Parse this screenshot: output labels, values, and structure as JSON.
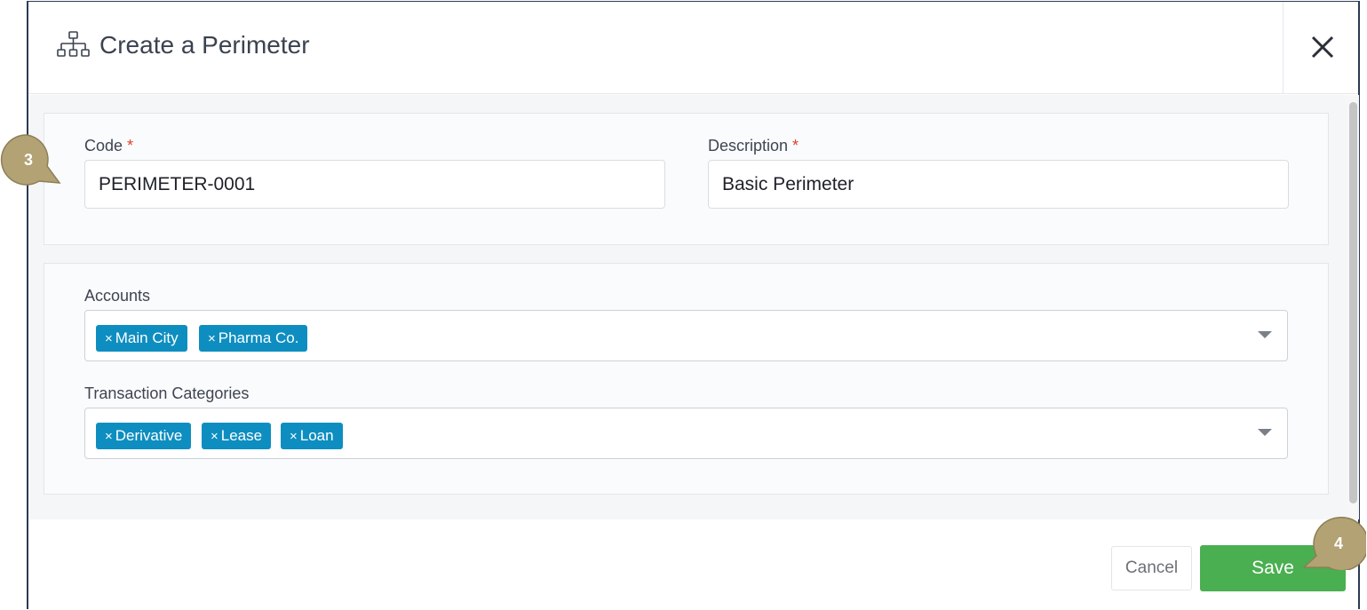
{
  "dialog": {
    "title": "Create a Perimeter",
    "title_icon": "sitemap-icon",
    "close_icon": "close-icon"
  },
  "form": {
    "code": {
      "label": "Code",
      "required_mark": "*",
      "value": "PERIMETER-0001"
    },
    "description": {
      "label": "Description",
      "required_mark": "*",
      "value": "Basic Perimeter"
    },
    "accounts": {
      "label": "Accounts",
      "tags": [
        "Main City",
        "Pharma Co."
      ]
    },
    "transaction_categories": {
      "label": "Transaction Categories",
      "tags": [
        "Derivative",
        "Lease",
        "Loan"
      ]
    },
    "tag_remove_glyph": "×"
  },
  "footer": {
    "cancel_label": "Cancel",
    "save_label": "Save"
  },
  "callouts": {
    "step_a": "3",
    "step_b": "4"
  },
  "colors": {
    "tag": "#0e8ec0",
    "save": "#4aaf50",
    "required": "#e0402e",
    "callout": "#b2a274"
  }
}
